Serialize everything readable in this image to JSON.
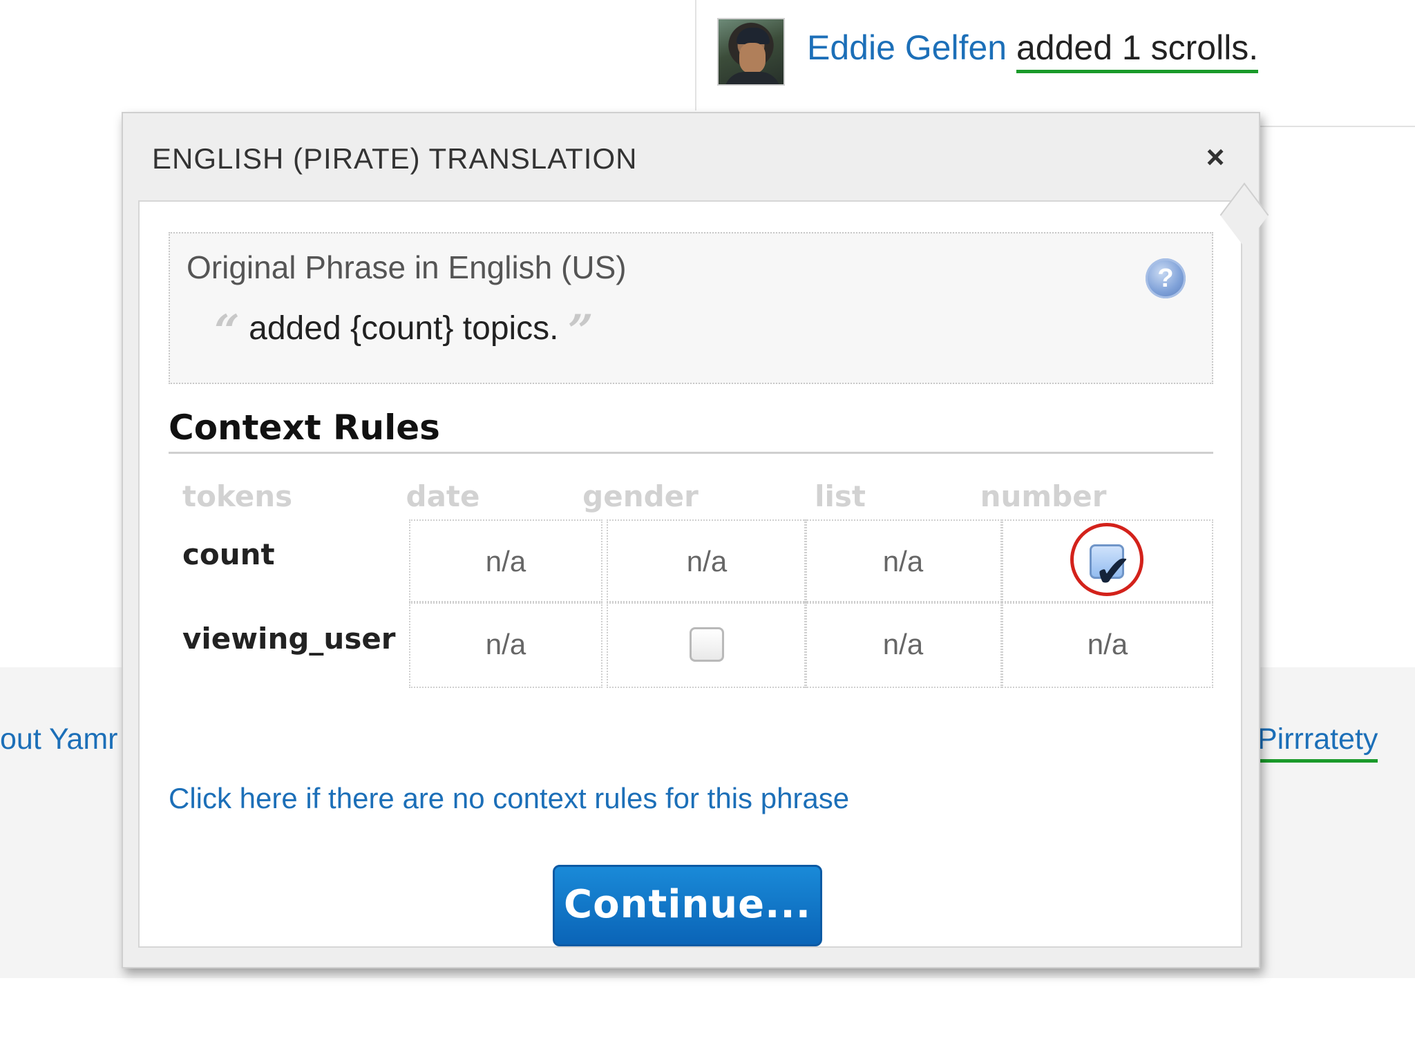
{
  "feed": {
    "user_name": "Eddie Gelfen",
    "action_text": "added 1 scrolls."
  },
  "background_links": {
    "left": "out Yamr",
    "right": "Pirrratety"
  },
  "popover": {
    "title": "ENGLISH (PIRATE) TRANSLATION",
    "close_label": "×",
    "phrase_heading": "Original Phrase in English (US)",
    "open_quote": "“",
    "phrase": "added {count} topics.",
    "close_quote": "”",
    "help_label": "?",
    "section_title": "Context Rules",
    "columns": [
      "tokens",
      "date",
      "gender",
      "list",
      "number"
    ],
    "rows": [
      {
        "token": "count",
        "date": "n/a",
        "gender": "n/a",
        "list": "n/a",
        "number_checked": true
      },
      {
        "token": "viewing_user",
        "date": "n/a",
        "gender_checked": false,
        "list": "n/a",
        "number": "n/a"
      }
    ],
    "no_rules_link": "Click here if there are no context rules for this phrase",
    "continue_label": "Continue..."
  },
  "colors": {
    "link": "#1c6fb8",
    "underline": "#1a9a2a",
    "button": "#0a64b7",
    "highlight": "#d3221b"
  }
}
